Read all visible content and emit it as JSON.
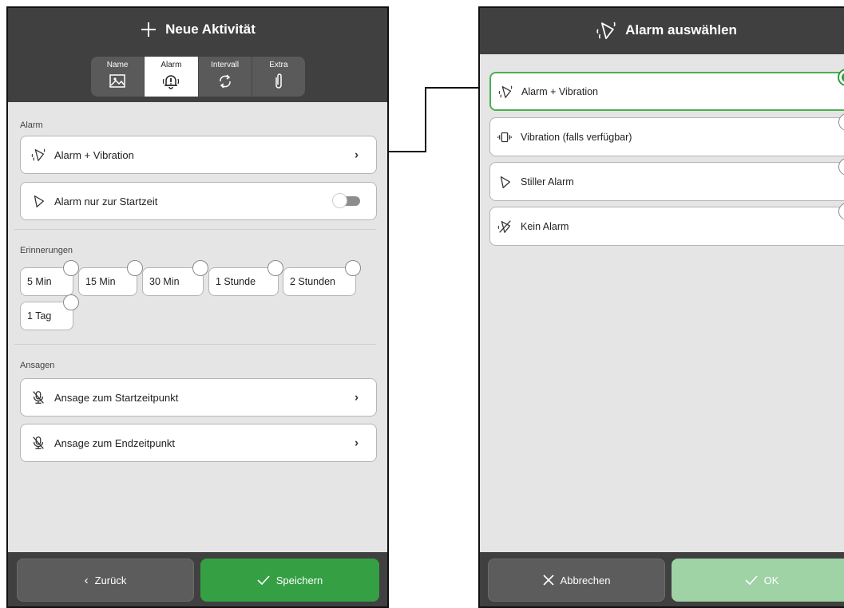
{
  "left": {
    "title": "Neue Aktivität",
    "tabs": [
      {
        "label": "Name",
        "icon": "image-icon"
      },
      {
        "label": "Alarm",
        "icon": "bell-alert-icon"
      },
      {
        "label": "Intervall",
        "icon": "repeat-icon"
      },
      {
        "label": "Extra",
        "icon": "paperclip-icon"
      }
    ],
    "active_tab": "Alarm",
    "alarm_section": {
      "label": "Alarm",
      "mode_label": "Alarm + Vibration",
      "start_label": "Alarm nur zur Startzeit",
      "start_toggle_on": false
    },
    "reminders": {
      "label": "Erinnerungen",
      "chips": [
        "5 Min",
        "15 Min",
        "30 Min",
        "1 Stunde",
        "2 Stunden",
        "1 Tag"
      ]
    },
    "announcements": {
      "label": "Ansagen",
      "start_label": "Ansage zum Startzeitpunkt",
      "end_label": "Ansage zum Endzeitpunkt"
    },
    "back_label": "Zurück",
    "save_label": "Speichern"
  },
  "right": {
    "title": "Alarm auswählen",
    "options": [
      {
        "label": "Alarm + Vibration",
        "icon": "bell-vibrate-icon",
        "selected": true
      },
      {
        "label": "Vibration (falls verfügbar)",
        "icon": "phone-vibrate-icon",
        "selected": false
      },
      {
        "label": "Stiller Alarm",
        "icon": "bell-outline-icon",
        "selected": false
      },
      {
        "label": "Kein Alarm",
        "icon": "bell-off-icon",
        "selected": false
      }
    ],
    "cancel_label": "Abbrechen",
    "ok_label": "OK"
  },
  "colors": {
    "header": "#404040",
    "background": "#e5e5e5",
    "accent_green": "#34a043",
    "accent_green_disabled": "#9fd2a5",
    "selected_border": "#4caf50"
  }
}
